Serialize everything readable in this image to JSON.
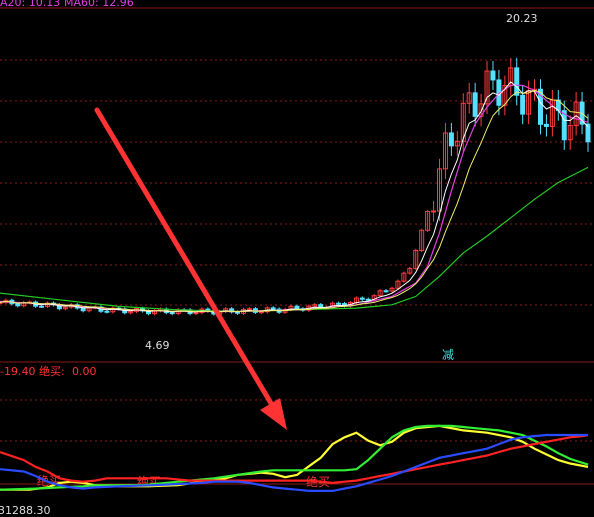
{
  "colors": {
    "background": "#000000",
    "grid": "#8b1a1a",
    "ma20": "#e040e0",
    "ma60": "#22cc22",
    "price_fast": "#ffffff",
    "price_slow": "#eeee66",
    "candle_up": "#ff3b3b",
    "candle_down": "#55e0ff",
    "ind_yellow": "#ffff33",
    "ind_green": "#33ee33",
    "ind_red": "#ff2222",
    "ind_blue": "#2a4bff",
    "arrow": "#ff3333",
    "label_red": "#ff3333",
    "label_cyan": "#44e0e0",
    "label_white": "#dddddd"
  },
  "header": {
    "ma20_label": "A20: 10.13",
    "ma60_label": "MA60: 12.96"
  },
  "price_panel": {
    "high_label": "20.23",
    "low_label": "4.69",
    "reduce_signal": "减",
    "ylim": [
      2,
      22
    ]
  },
  "indicator_panel": {
    "value_label": "-19.40",
    "signal_title": "绝买:",
    "signal_value": "0.00",
    "buy_signals": [
      "绝买",
      "绝买",
      "绝买"
    ],
    "ylim": [
      0,
      100
    ]
  },
  "bottom_panel": {
    "partial_label": "31288.30"
  },
  "chart_data": [
    {
      "type": "line",
      "name": "price-panel",
      "x_count": 100,
      "series": [
        {
          "name": "MA20",
          "x": [
            0,
            10,
            20,
            30,
            40,
            50,
            60,
            66,
            70,
            72,
            74,
            76,
            78,
            80,
            82,
            84,
            86,
            88,
            90,
            92,
            94,
            96,
            99
          ],
          "y": [
            4.9,
            4.7,
            4.4,
            4.3,
            4.3,
            4.4,
            4.7,
            5.2,
            6.0,
            7.0,
            9.0,
            11.5,
            13.8,
            15.5,
            16.5,
            17.3,
            17.8,
            17.8,
            17.5,
            16.9,
            16.3,
            15.9,
            15.6
          ]
        },
        {
          "name": "MA60",
          "x": [
            0,
            10,
            20,
            30,
            40,
            50,
            60,
            66,
            70,
            74,
            78,
            82,
            86,
            90,
            94,
            99
          ],
          "y": [
            5.4,
            5.0,
            4.6,
            4.4,
            4.3,
            4.4,
            4.5,
            4.7,
            5.2,
            6.4,
            7.8,
            8.8,
            9.9,
            11.0,
            12.0,
            12.9
          ]
        }
      ],
      "annotations": [
        "20.23",
        "4.69"
      ]
    },
    {
      "type": "line",
      "name": "indicator-panel",
      "x_count": 100,
      "series": [
        {
          "color": "yellow",
          "x": [
            0,
            5,
            8,
            10,
            12,
            14,
            16,
            20,
            25,
            30,
            35,
            38,
            40,
            42,
            44,
            46,
            48,
            50,
            54,
            56,
            58,
            60,
            62,
            64,
            66,
            68,
            70,
            74,
            78,
            82,
            86,
            88,
            90,
            92,
            94,
            96,
            99
          ],
          "y": [
            2,
            2,
            4,
            8,
            9,
            8,
            6,
            5,
            5,
            6,
            10,
            12,
            15,
            16,
            17,
            16,
            13,
            15,
            30,
            42,
            48,
            52,
            45,
            41,
            44,
            52,
            56,
            58,
            54,
            52,
            48,
            44,
            38,
            33,
            28,
            25,
            22
          ]
        },
        {
          "color": "green",
          "x": [
            0,
            6,
            10,
            14,
            16,
            20,
            24,
            30,
            36,
            40,
            44,
            46,
            48,
            50,
            54,
            58,
            60,
            62,
            64,
            66,
            68,
            70,
            72,
            74,
            76,
            78,
            80,
            82,
            84,
            86,
            88,
            90,
            92,
            94,
            96,
            99
          ],
          "y": [
            2,
            3,
            4,
            5,
            6,
            6,
            6,
            9,
            12,
            15,
            18,
            19,
            19,
            19,
            19,
            19,
            20,
            28,
            38,
            48,
            54,
            57,
            58,
            58,
            58,
            57,
            56,
            55,
            54,
            52,
            50,
            45,
            40,
            34,
            29,
            24
          ]
        },
        {
          "color": "red",
          "x": [
            0,
            4,
            6,
            8,
            10,
            12,
            14,
            16,
            18,
            20,
            22,
            24,
            28,
            32,
            36,
            40,
            42,
            44,
            46,
            48,
            50,
            52,
            54,
            56,
            58,
            60,
            62,
            64,
            66,
            68,
            70,
            72,
            74,
            76,
            78,
            80,
            82,
            84,
            86,
            88,
            90,
            92,
            94,
            96,
            98,
            99
          ],
          "y": [
            35,
            28,
            22,
            18,
            12,
            10,
            9,
            10,
            12,
            12,
            12,
            12,
            12,
            10,
            10,
            10,
            10,
            10,
            10,
            10,
            10,
            10,
            9,
            8,
            9,
            10,
            12,
            14,
            16,
            18,
            20,
            22,
            24,
            26,
            28,
            30,
            32,
            35,
            38,
            40,
            42,
            44,
            46,
            48,
            49,
            50
          ]
        },
        {
          "color": "blue",
          "x": [
            0,
            4,
            6,
            8,
            10,
            12,
            14,
            16,
            20,
            26,
            30,
            34,
            36,
            40,
            42,
            44,
            46,
            48,
            50,
            52,
            54,
            56,
            58,
            60,
            62,
            64,
            66,
            68,
            70,
            72,
            74,
            76,
            78,
            80,
            82,
            84,
            86,
            88,
            90,
            92,
            94,
            96,
            98,
            99
          ],
          "y": [
            20,
            18,
            14,
            9,
            6,
            4,
            3,
            4,
            5,
            6,
            7,
            8,
            9,
            9,
            8,
            6,
            4,
            3,
            2,
            1,
            1,
            1,
            3,
            5,
            8,
            11,
            14,
            18,
            22,
            26,
            30,
            32,
            34,
            36,
            38,
            42,
            46,
            48,
            49,
            50,
            50,
            50,
            50,
            50
          ]
        }
      ],
      "annotations": [
        "绝买",
        "绝买",
        "绝买"
      ]
    }
  ]
}
